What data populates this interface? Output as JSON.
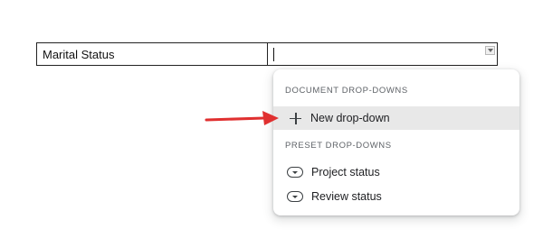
{
  "table": {
    "label": "Marital Status",
    "value": ""
  },
  "menu": {
    "document_section": "DOCUMENT DROP-DOWNS",
    "new_item": "New drop-down",
    "preset_section": "PRESET DROP-DOWNS",
    "presets": [
      {
        "label": "Project status",
        "icon": "dropdown-chip-icon"
      },
      {
        "label": "Review status",
        "icon": "dropdown-chip-icon"
      }
    ]
  },
  "colors": {
    "arrow": "#e03030",
    "highlight": "#e8e8e8",
    "section_text": "#5f6368"
  },
  "icons": {
    "new_item": "plus-icon",
    "cell_dropdown": "chevron-down-icon",
    "annotation": "red-arrow-icon"
  }
}
